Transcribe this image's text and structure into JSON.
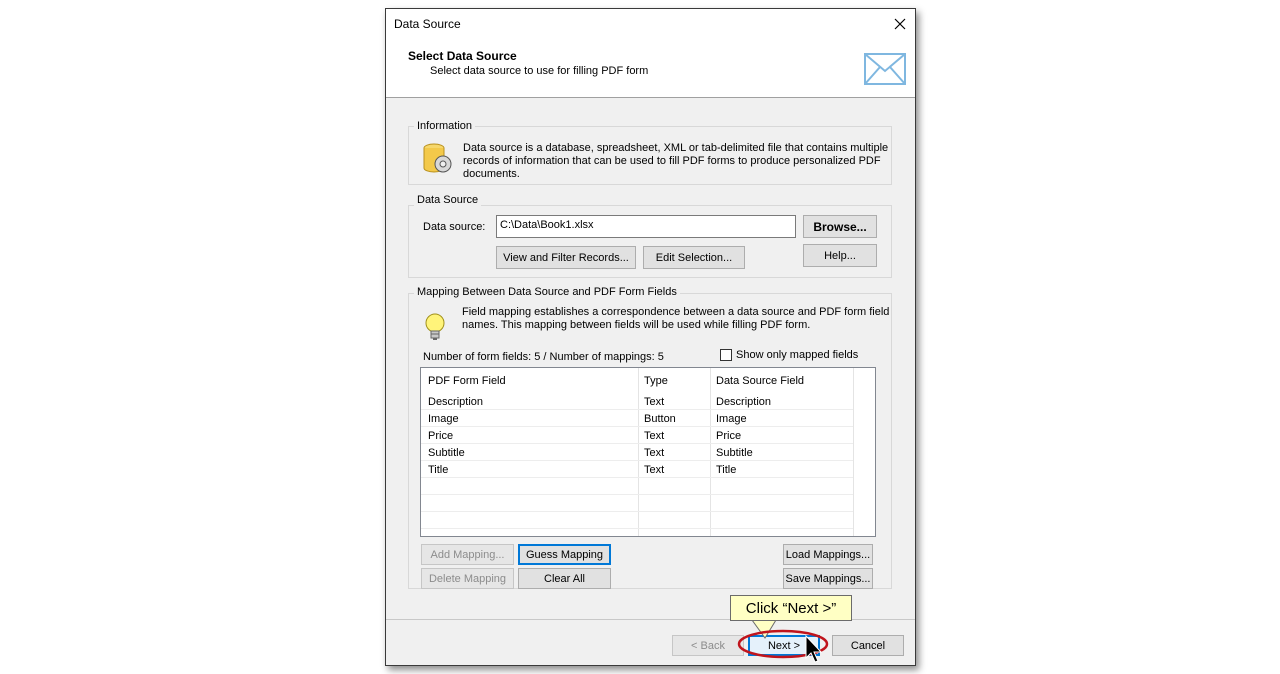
{
  "window": {
    "title": "Data Source"
  },
  "header": {
    "title": "Select Data Source",
    "subtitle": "Select data source to use for filling PDF form",
    "icon": "envelope-icon"
  },
  "information": {
    "label": "Information",
    "text_lines": [
      "Data source is a database, spreadsheet, XML or tab-delimited file that contains multiple",
      "records of information that can be used to fill PDF forms to produce personalized PDF",
      "documents."
    ]
  },
  "data_source": {
    "label": "Data Source",
    "field_label": "Data source:",
    "value": "C:\\Data\\Book1.xlsx",
    "browse": "Browse...",
    "help": "Help...",
    "view_filter": "View and Filter Records...",
    "edit_selection": "Edit Selection..."
  },
  "mapping": {
    "label": "Mapping Between Data Source and PDF Form Fields",
    "text_lines": [
      "Field mapping establishes a correspondence between a data source and PDF form field",
      "names. This mapping between fields will be used while filling PDF form."
    ],
    "counts": "Number of form fields: 5 / Number of mappings: 5",
    "show_only_mapped": "Show only mapped fields",
    "show_only_mapped_checked": false,
    "columns": [
      "PDF Form Field",
      "Type",
      "Data Source Field"
    ],
    "rows": [
      [
        "Description",
        "Text",
        "Description"
      ],
      [
        "Image",
        "Button",
        "Image"
      ],
      [
        "Price",
        "Text",
        "Price"
      ],
      [
        "Subtitle",
        "Text",
        "Subtitle"
      ],
      [
        "Title",
        "Text",
        "Title"
      ]
    ],
    "add_mapping": "Add Mapping...",
    "guess_mapping": "Guess Mapping",
    "load_mappings": "Load Mappings...",
    "delete_mapping": "Delete Mapping",
    "clear_all": "Clear All",
    "save_mappings": "Save Mappings..."
  },
  "footer": {
    "back": "< Back",
    "next": "Next >",
    "cancel": "Cancel"
  },
  "annotation": {
    "callout": "Click “Next >”",
    "highlight_color": "#c0141c",
    "callout_color": "#ffffc4"
  }
}
